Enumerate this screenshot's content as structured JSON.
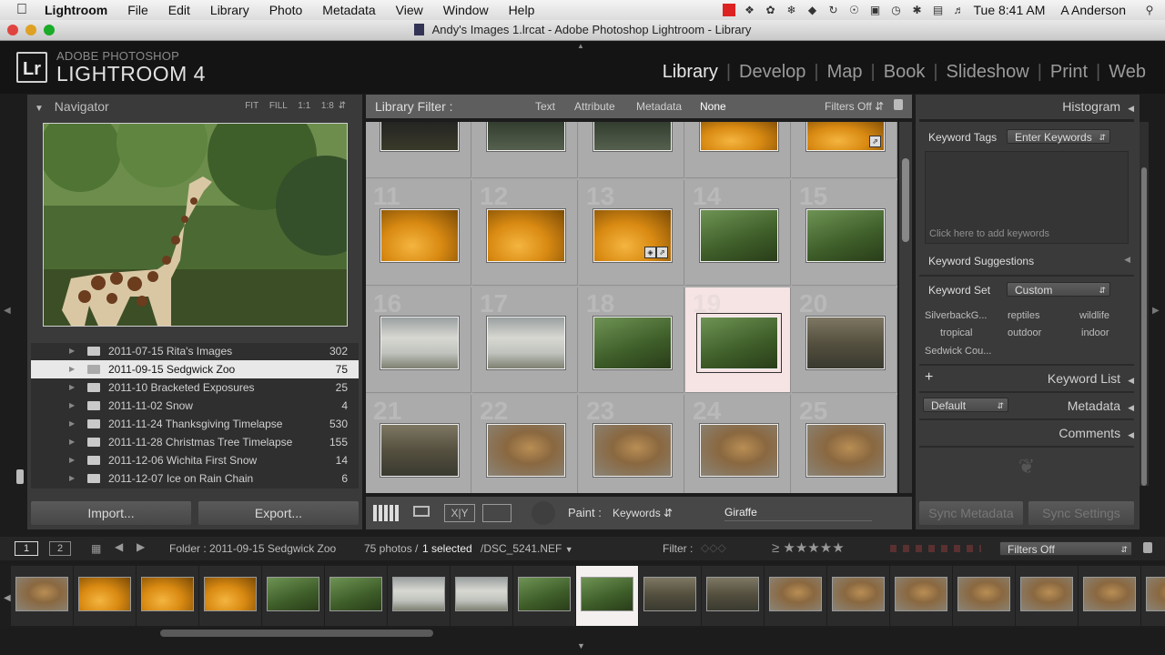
{
  "menubar": {
    "app": "Lightroom",
    "items": [
      "File",
      "Edit",
      "Library",
      "Photo",
      "Metadata",
      "View",
      "Window",
      "Help"
    ],
    "clock": "Tue 8:41 AM",
    "user": "A Anderson"
  },
  "window": {
    "title": "Andy's Images 1.lrcat - Adobe Photoshop Lightroom - Library"
  },
  "identity": {
    "logo": "Lr",
    "top": "ADOBE PHOTOSHOP",
    "main": "LIGHTROOM 4"
  },
  "modules": [
    "Library",
    "Develop",
    "Map",
    "Book",
    "Slideshow",
    "Print",
    "Web"
  ],
  "left": {
    "navigator": {
      "title": "Navigator",
      "zoom": [
        "FIT",
        "FILL",
        "1:1",
        "1:8"
      ]
    },
    "folders": [
      {
        "name": "2011-07-15 Rita's Images",
        "count": "302"
      },
      {
        "name": "2011-09-15 Sedgwick Zoo",
        "count": "75",
        "selected": true
      },
      {
        "name": "2011-10 Bracketed Exposures",
        "count": "25"
      },
      {
        "name": "2011-11-02 Snow",
        "count": "4"
      },
      {
        "name": "2011-11-24 Thanksgiving Timelapse",
        "count": "530"
      },
      {
        "name": "2011-11-28 Christmas Tree Timelapse",
        "count": "155"
      },
      {
        "name": "2011-12-06 Wichita First Snow",
        "count": "14"
      },
      {
        "name": "2011-12-07 Ice on Rain Chain",
        "count": "6"
      }
    ],
    "import": "Import...",
    "export": "Export..."
  },
  "filter": {
    "label": "Library Filter :",
    "tabs": [
      "Text",
      "Attribute",
      "Metadata",
      "None"
    ],
    "active": "None",
    "preset": "Filters Off"
  },
  "grid": {
    "rows": [
      {
        "nums": [
          "",
          "",
          "",
          "",
          ""
        ],
        "thumbs": [
          "dark",
          "waterfall",
          "waterfall",
          "orange",
          "orange"
        ]
      },
      {
        "nums": [
          "11",
          "12",
          "13",
          "14",
          "15"
        ],
        "thumbs": [
          "orange",
          "orange",
          "orange",
          "giraffe",
          "giraffe"
        ]
      },
      {
        "nums": [
          "16",
          "17",
          "18",
          "19",
          "20"
        ],
        "thumbs": [
          "geese",
          "geese",
          "giraffe",
          "giraffe",
          "rhino"
        ]
      },
      {
        "nums": [
          "21",
          "22",
          "23",
          "24",
          "25"
        ],
        "thumbs": [
          "rhino",
          "lion",
          "lion",
          "lion",
          "lion"
        ]
      }
    ],
    "selected_index": "19"
  },
  "toolbar": {
    "paint_label": "Paint :",
    "paint_mode": "Keywords",
    "keyword_value": "Giraffe"
  },
  "right": {
    "histogram": "Histogram",
    "keyword_tags_label": "Keyword Tags",
    "keyword_tags_mode": "Enter Keywords",
    "keyword_placeholder": "Click here to add keywords",
    "suggestions_title": "Keyword Suggestions",
    "keyword_set_label": "Keyword Set",
    "keyword_set_value": "Custom",
    "keyword_grid": [
      "SilverbackG...",
      "reptiles",
      "wildlife",
      "tropical",
      "outdoor",
      "indoor",
      "Sedwick Cou..."
    ],
    "keyword_list": "Keyword List",
    "metadata_preset": "Default",
    "metadata": "Metadata",
    "comments": "Comments",
    "sync_metadata": "Sync Metadata",
    "sync_settings": "Sync Settings"
  },
  "filmstrip": {
    "page1": "1",
    "page2": "2",
    "folder_label": "Folder : 2011-09-15 Sedgwick Zoo",
    "photos_count": "75 photos /",
    "selected_count": "1 selected",
    "filename": "/DSC_5241.NEF",
    "filter_label": "Filter :",
    "filter_preset": "Filters Off",
    "thumbs": [
      "lion",
      "orange",
      "orange",
      "orange",
      "giraffe",
      "giraffe",
      "geese",
      "geese",
      "giraffe",
      "giraffe",
      "rhino",
      "rhino",
      "lion",
      "lion",
      "lion",
      "lion",
      "lion",
      "lion",
      "lion"
    ],
    "selected_index": 9
  }
}
